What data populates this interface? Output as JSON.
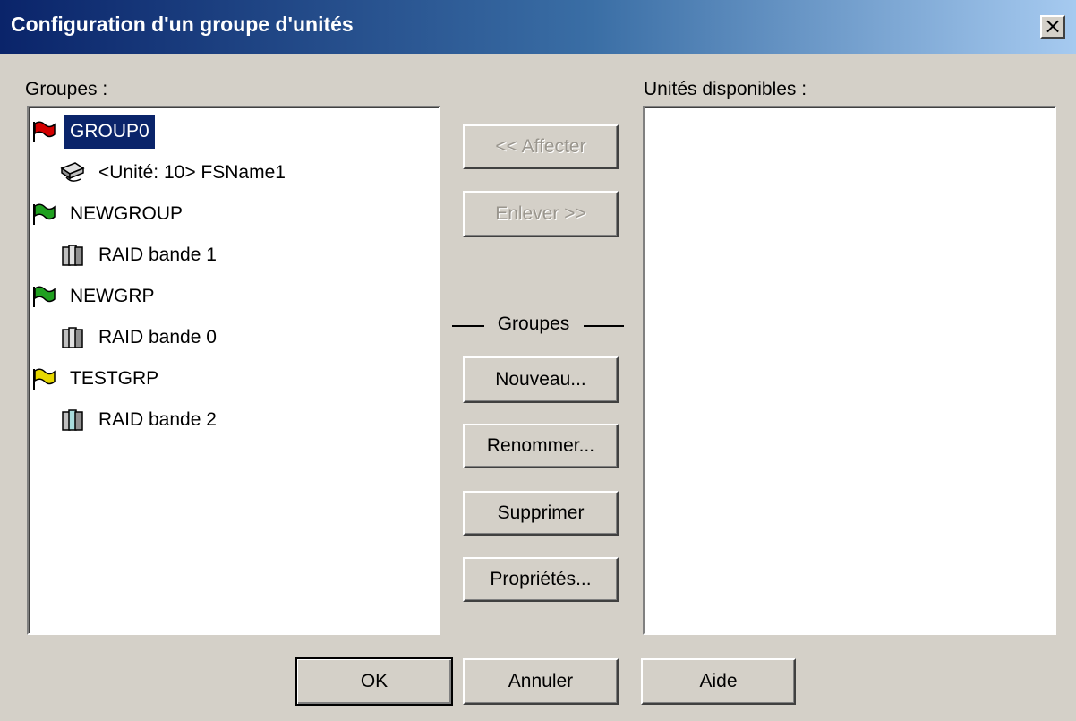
{
  "window": {
    "title": "Configuration d'un groupe d'unités",
    "close_label": "×"
  },
  "left": {
    "label": "Groupes :",
    "tree": [
      {
        "label": "GROUP0",
        "type": "group",
        "flag_color": "red",
        "selected": true
      },
      {
        "label": "<Unité: 10> FSName1",
        "type": "device"
      },
      {
        "label": "NEWGROUP",
        "type": "group",
        "flag_color": "green"
      },
      {
        "label": "RAID bande 1",
        "type": "raid"
      },
      {
        "label": "NEWGRP",
        "type": "group",
        "flag_color": "green"
      },
      {
        "label": "RAID bande 0",
        "type": "raid"
      },
      {
        "label": "TESTGRP",
        "type": "group",
        "flag_color": "yellow"
      },
      {
        "label": "RAID bande 2",
        "type": "raid"
      }
    ]
  },
  "right": {
    "label": "Unités disponibles :"
  },
  "middle": {
    "assign": "<< Affecter",
    "remove": "Enlever >>",
    "groups_section": "Groupes",
    "new": "Nouveau...",
    "rename": "Renommer...",
    "delete": "Supprimer",
    "properties": "Propriétés..."
  },
  "footer": {
    "ok": "OK",
    "cancel": "Annuler",
    "help": "Aide"
  }
}
